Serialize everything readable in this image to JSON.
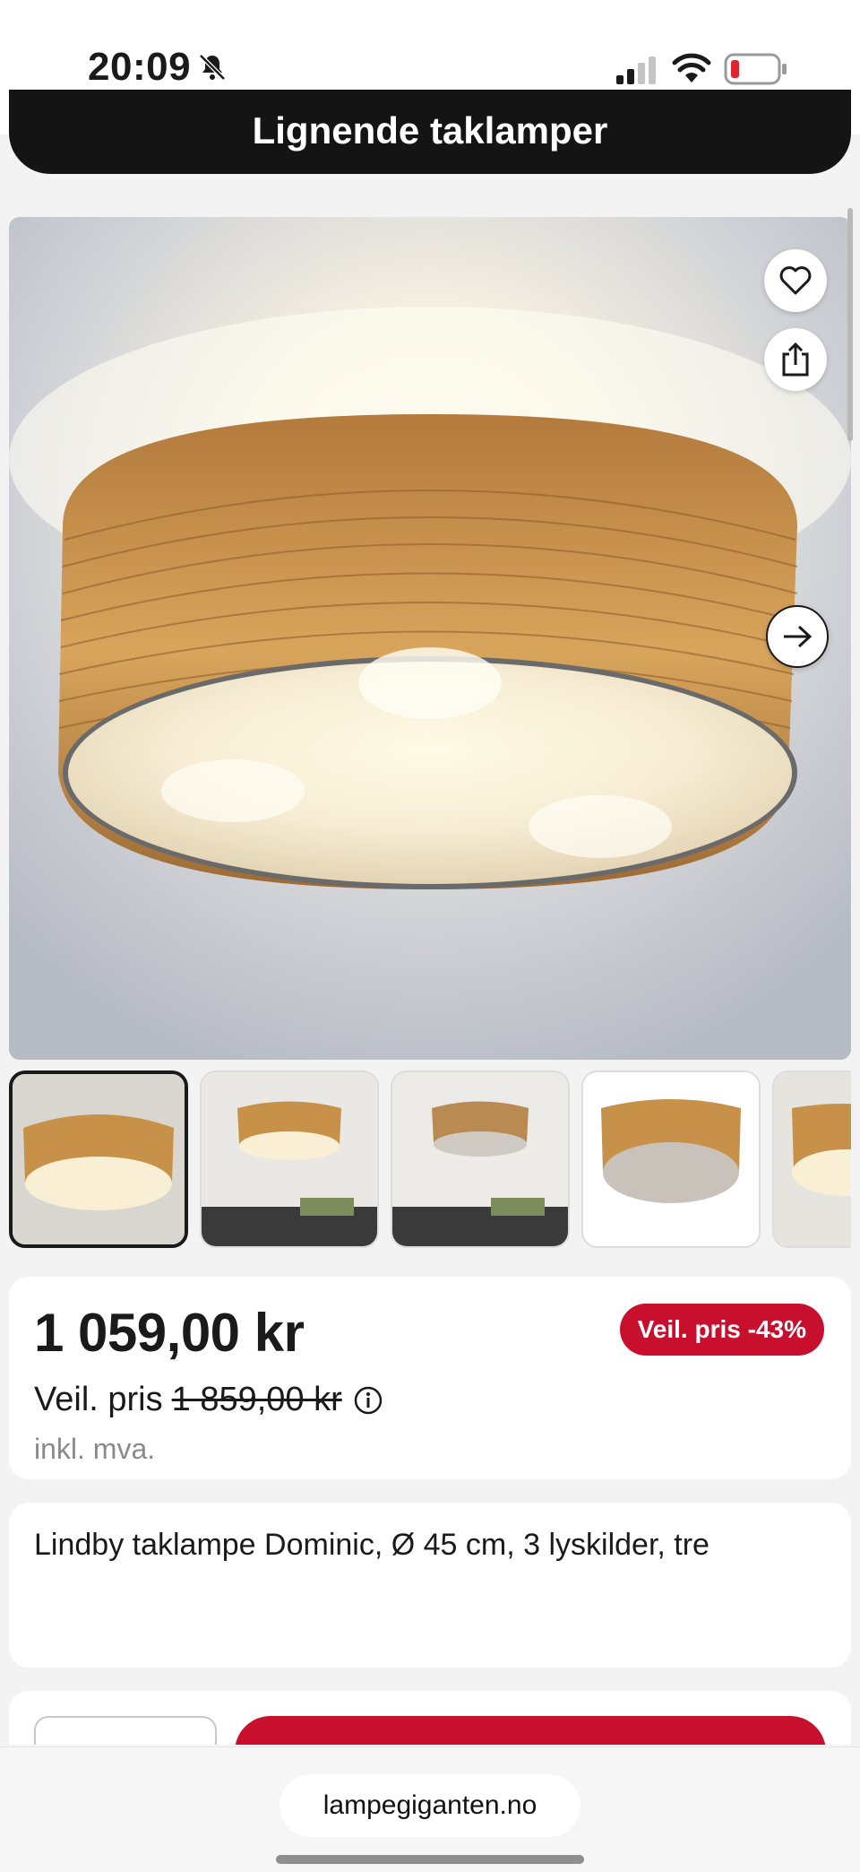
{
  "status_bar": {
    "time": "20:09"
  },
  "similar_button": {
    "label": "Lignende taklamper"
  },
  "gallery": {
    "image_count": 5,
    "active_index": 0
  },
  "price": {
    "current": "1 059,00 kr",
    "recommended_label": "Veil. pris",
    "recommended_old": "1 859,00 kr",
    "badge": "Veil. pris -43%",
    "vat_note": "inkl. mva."
  },
  "product": {
    "title": "Lindby taklampe Dominic, Ø 45 cm, 3 lyskilder, tre"
  },
  "browser": {
    "url": "lampegiganten.no"
  },
  "colors": {
    "accent_red": "#c8102e",
    "dark": "#141414"
  }
}
